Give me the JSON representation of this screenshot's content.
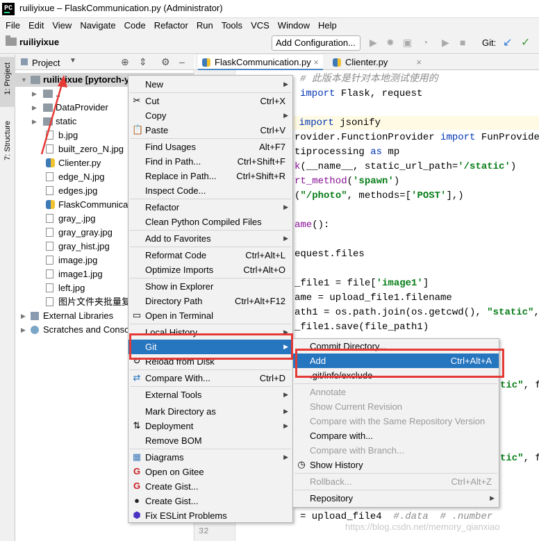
{
  "window": {
    "title": "ruiliyixue – FlaskCommunication.py (Administrator)",
    "app_icon_text": "PC"
  },
  "menubar": [
    "File",
    "Edit",
    "View",
    "Navigate",
    "Code",
    "Refactor",
    "Run",
    "Tools",
    "VCS",
    "Window",
    "Help"
  ],
  "toolbar": {
    "project": "ruiliyixue",
    "config_button": "Add Configuration...",
    "git_label": "Git:"
  },
  "side_tabs": {
    "project": "1: Project",
    "structure": "7: Structure"
  },
  "project_panel": {
    "header": "Project",
    "tree": [
      {
        "label": "ruiliyixue [pytorch-yo",
        "type": "root",
        "expanded": true,
        "selected": true
      },
      {
        "label": "..",
        "type": "folder"
      },
      {
        "label": "DataProvider",
        "type": "folder"
      },
      {
        "label": "static",
        "type": "folder"
      },
      {
        "label": "b.jpg",
        "type": "file"
      },
      {
        "label": "built_zero_N.jpg",
        "type": "file"
      },
      {
        "label": "Clienter.py",
        "type": "py"
      },
      {
        "label": "edge_N.jpg",
        "type": "file"
      },
      {
        "label": "edges.jpg",
        "type": "file"
      },
      {
        "label": "FlaskCommunicati",
        "type": "py"
      },
      {
        "label": "gray_.jpg",
        "type": "file"
      },
      {
        "label": "gray_gray.jpg",
        "type": "file"
      },
      {
        "label": "gray_hist.jpg",
        "type": "file"
      },
      {
        "label": "image.jpg",
        "type": "file"
      },
      {
        "label": "image1.jpg",
        "type": "file"
      },
      {
        "label": "left.jpg",
        "type": "file"
      },
      {
        "label": "图片文件夹批量复制",
        "type": "file"
      },
      {
        "label": "External Libraries",
        "type": "lib"
      },
      {
        "label": "Scratches and Conso",
        "type": "scr"
      }
    ]
  },
  "editor": {
    "tabs": [
      {
        "label": "FlaskCommunication.py",
        "active": true
      },
      {
        "label": "Clienter.py",
        "active": false
      }
    ],
    "visible_line_number": "32",
    "lines": [
      "# 此版本是针对本地测试使用的",
      "import Flask, request",
      "",
      "import jsonify",
      "rovider.FunctionProvider import FunProvider",
      "tiprocessing as mp",
      "k(__name__, static_url_path='/static')",
      "rt_method('spawn')",
      "(\"/photo\", methods=['POST'],)",
      "",
      "ame():",
      "",
      "equest.files",
      "",
      "_file1 = file['image1']",
      "ame = upload_file1.filename",
      "ath1 = os.path.join(os.getcwd(), \"static\", f",
      "_file1.save(file_path1)",
      "",
      "",
      "tic\", f",
      "",
      "",
      "",
      "",
      "tic\", f",
      "",
      "",
      "",
      "",
      "= upload_file4  #.data  # .number"
    ]
  },
  "context_menu": [
    {
      "label": "New",
      "submenu": true
    },
    {
      "label": "Cut",
      "shortcut": "Ctrl+X",
      "icon": "scissors-icon"
    },
    {
      "label": "Copy",
      "submenu": true
    },
    {
      "label": "Paste",
      "shortcut": "Ctrl+V",
      "icon": "clipboard-icon"
    },
    {
      "label": "Find Usages",
      "shortcut": "Alt+F7"
    },
    {
      "label": "Find in Path...",
      "shortcut": "Ctrl+Shift+F"
    },
    {
      "label": "Replace in Path...",
      "shortcut": "Ctrl+Shift+R"
    },
    {
      "label": "Inspect Code..."
    },
    {
      "label": "Refactor",
      "submenu": true
    },
    {
      "label": "Clean Python Compiled Files"
    },
    {
      "label": "Add to Favorites",
      "submenu": true
    },
    {
      "label": "Reformat Code",
      "shortcut": "Ctrl+Alt+L"
    },
    {
      "label": "Optimize Imports",
      "shortcut": "Ctrl+Alt+O"
    },
    {
      "label": "Show in Explorer"
    },
    {
      "label": "Directory Path",
      "shortcut": "Ctrl+Alt+F12"
    },
    {
      "label": "Open in Terminal",
      "icon": "terminal-icon"
    },
    {
      "label": "Local History",
      "submenu": true
    },
    {
      "label": "Git",
      "submenu": true,
      "highlighted": true
    },
    {
      "label": "Reload from Disk",
      "icon": "reload-icon"
    },
    {
      "label": "Compare With...",
      "shortcut": "Ctrl+D",
      "icon": "compare-icon"
    },
    {
      "label": "External Tools",
      "submenu": true
    },
    {
      "label": "Mark Directory as",
      "submenu": true
    },
    {
      "label": "Deployment",
      "submenu": true,
      "icon": "deployment-icon"
    },
    {
      "label": "Remove BOM"
    },
    {
      "label": "Diagrams",
      "submenu": true,
      "icon": "diagram-icon"
    },
    {
      "label": "Open on Gitee",
      "icon": "gitee-icon"
    },
    {
      "label": "Create Gist...",
      "icon": "gitee-icon"
    },
    {
      "label": "Create Gist...",
      "icon": "github-icon"
    },
    {
      "label": "Fix ESLint Problems",
      "icon": "eslint-icon"
    }
  ],
  "git_submenu": [
    {
      "label": "Commit Directory..."
    },
    {
      "label": "Add",
      "shortcut": "Ctrl+Alt+A",
      "highlighted": true
    },
    {
      "label": ".git/info/exclude"
    },
    {
      "label": "Annotate",
      "disabled": true
    },
    {
      "label": "Show Current Revision",
      "disabled": true
    },
    {
      "label": "Compare with the Same Repository Version",
      "disabled": true
    },
    {
      "label": "Compare with..."
    },
    {
      "label": "Compare with Branch...",
      "disabled": true
    },
    {
      "label": "Show History",
      "icon": "clock-icon"
    },
    {
      "label": "Rollback...",
      "shortcut": "Ctrl+Alt+Z",
      "disabled": true
    },
    {
      "label": "Repository",
      "submenu": true
    }
  ],
  "watermark": "https://blog.csdn.net/memory_qianxiao",
  "colors": {
    "highlight": "#2675bf",
    "annotation_red": "#e53935",
    "menu_bg": "#f2f2f2"
  }
}
